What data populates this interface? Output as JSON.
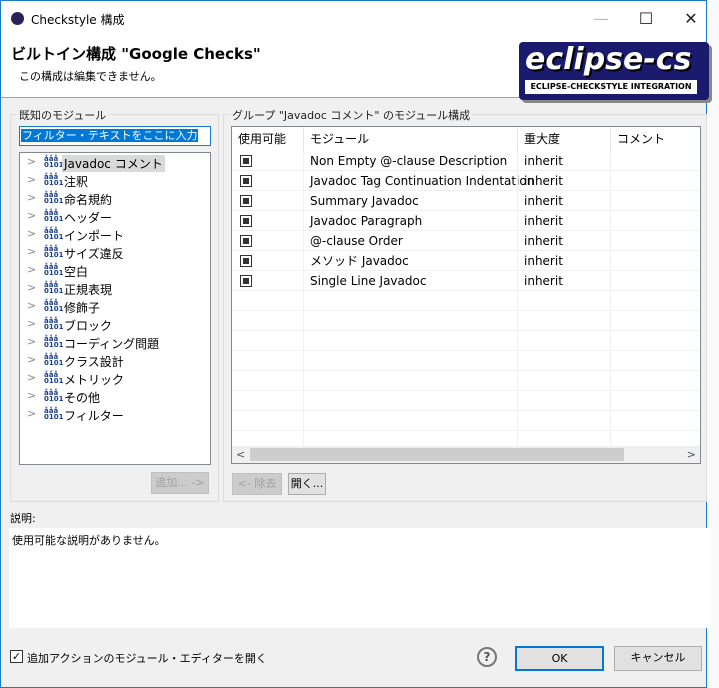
{
  "window": {
    "title": "Checkstyle 構成",
    "minimize": "—",
    "maximize": "☐",
    "close": "✕"
  },
  "header": {
    "title": "ビルトイン構成 \"Google Checks\"",
    "subtitle": "この構成は編集できません。",
    "logo_text": "eclipse-cs",
    "logo_subtitle": "ECLIPSE-CHECKSTYLE INTEGRATION"
  },
  "known_modules": {
    "label": "既知のモジュール",
    "filter_value": "フィルター・テキストをここに入力",
    "items": [
      "Javadoc コメント",
      "注釈",
      "命名規約",
      "ヘッダー",
      "インポート",
      "サイズ違反",
      "空白",
      "正規表現",
      "修飾子",
      "ブロック",
      "コーディング問題",
      "クラス設計",
      "メトリック",
      "その他",
      "フィルター"
    ],
    "selected": 0,
    "add_button": "追加... ->"
  },
  "configured": {
    "label": "グループ \"Javadoc コメント\" のモジュール構成",
    "columns": [
      "使用可能",
      "モジュール",
      "重大度",
      "コメント"
    ],
    "rows": [
      {
        "enabled": true,
        "module": "Non Empty @-clause Description",
        "severity": "inherit",
        "comment": ""
      },
      {
        "enabled": true,
        "module": "Javadoc Tag Continuation Indentation",
        "severity": "inherit",
        "comment": ""
      },
      {
        "enabled": true,
        "module": "Summary Javadoc",
        "severity": "inherit",
        "comment": ""
      },
      {
        "enabled": true,
        "module": "Javadoc Paragraph",
        "severity": "inherit",
        "comment": ""
      },
      {
        "enabled": true,
        "module": "@-clause Order",
        "severity": "inherit",
        "comment": ""
      },
      {
        "enabled": true,
        "module": "メソッド Javadoc",
        "severity": "inherit",
        "comment": ""
      },
      {
        "enabled": true,
        "module": "Single Line Javadoc",
        "severity": "inherit",
        "comment": ""
      }
    ],
    "remove_button": "<- 除去",
    "open_button": "開く..."
  },
  "description": {
    "label": "説明:",
    "text": "使用可能な説明がありません。"
  },
  "footer": {
    "checkbox_label": "追加アクションのモジュール・エディターを開く",
    "checkbox_checked": true,
    "help": "?",
    "ok": "OK",
    "cancel": "キャンセル"
  }
}
